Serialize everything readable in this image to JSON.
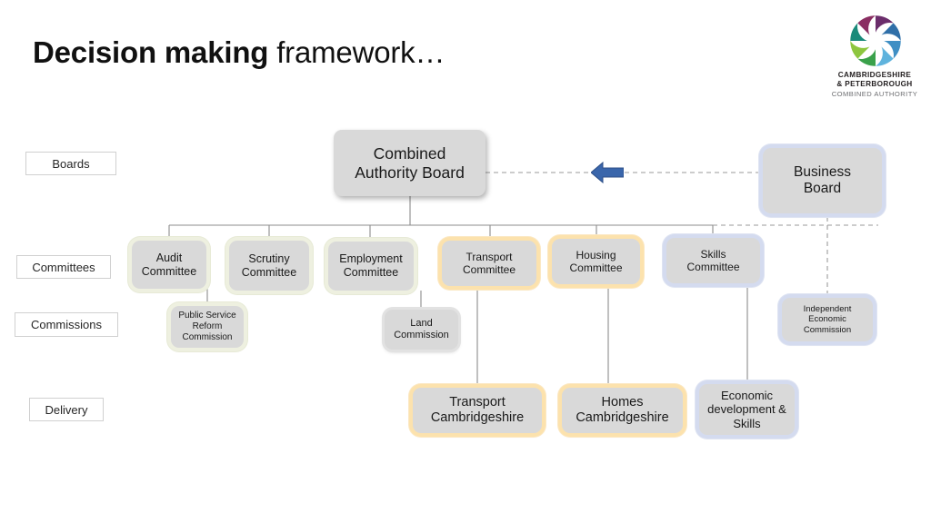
{
  "title": {
    "strong": "Decision making",
    "light": " framework…"
  },
  "logo": {
    "mark": "cambridgeshire-peterborough-pinwheel-logo",
    "line1": "CAMBRIDGESHIRE",
    "line2": "& PETERBOROUGH",
    "line3": "COMBINED AUTHORITY",
    "colors": {
      "purple": "#6b2d6b",
      "magenta": "#8a2e62",
      "teal": "#1d7b8a",
      "blue": "#2f7fb5",
      "light_blue": "#57a9d8",
      "green": "#3aa14b",
      "light_green": "#8dc63f",
      "dark_teal": "#1a6f5e"
    }
  },
  "categories": [
    {
      "label": "Boards"
    },
    {
      "label": "Committees"
    },
    {
      "label": "Commissions"
    },
    {
      "label": "Delivery"
    }
  ],
  "nodes": {
    "combined_authority_board": "Combined\nAuthority Board",
    "business_board": "Business\nBoard",
    "audit_committee": "Audit\nCommittee",
    "scrutiny_committee": "Scrutiny\nCommittee",
    "employment_committee": "Employment\nCommittee",
    "transport_committee": "Transport\nCommittee",
    "housing_committee": "Housing\nCommittee",
    "skills_committee": "Skills\nCommittee",
    "public_service_reform_commission": "Public Service\nReform\nCommission",
    "land_commission": "Land\nCommission",
    "independent_economic_commission": "Independent\nEconomic\nCommission",
    "transport_cambridgeshire": "Transport\nCambridgeshire",
    "homes_cambridgeshire": "Homes\nCambridgeshire",
    "economic_development_skills": "Economic\ndevelopment &\nSkills"
  },
  "arrow": {
    "name": "business-board-to-ca-board-arrow",
    "direction": "left",
    "color": "#3a66ab"
  },
  "colors": {
    "node_fill": "#d9d9d9",
    "glow_olive": "#eef0e0",
    "glow_amber": "#fce2ad",
    "glow_blue": "#d4dbef",
    "connector": "#7f7f7f",
    "dashed_connector": "#9a9a9a"
  }
}
